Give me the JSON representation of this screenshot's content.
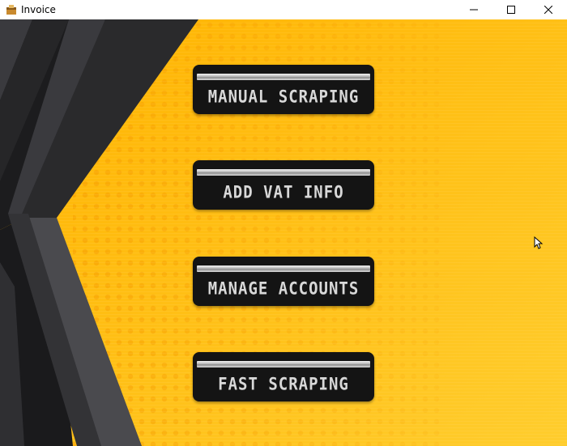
{
  "window": {
    "title": "Invoice",
    "controls": {
      "minimize": "minimize-icon",
      "maximize": "maximize-icon",
      "close": "close-icon"
    }
  },
  "menu": {
    "buttons": [
      {
        "label": "MANUAL SCRAPING"
      },
      {
        "label": "ADD VAT INFO"
      },
      {
        "label": "MANAGE ACCOUNTS"
      },
      {
        "label": "FAST SCRAPING"
      }
    ]
  },
  "colors": {
    "background": "#ffc21a",
    "button": "#141414",
    "button_text": "#d8d8d8",
    "stripe_dark": "#2a2a2c",
    "stripe_gray": "#4a4a4e"
  }
}
